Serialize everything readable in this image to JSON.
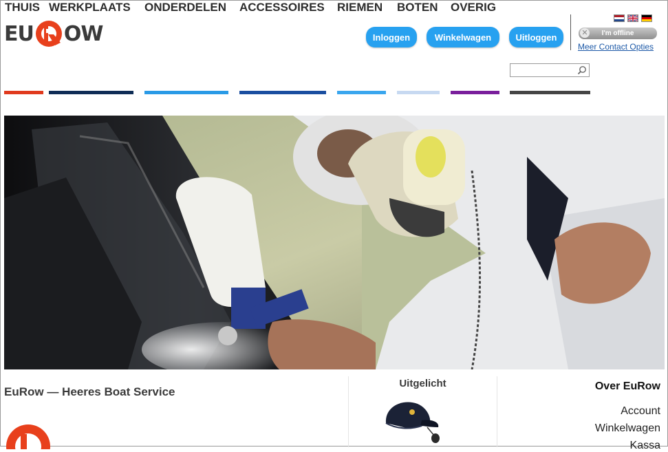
{
  "brand": {
    "logo_left": "EU",
    "logo_right": "OW",
    "accent_color": "#e8401c"
  },
  "header": {
    "buttons": {
      "login": "Inloggen",
      "cart": "Winkelwagen",
      "logout": "Uitloggen"
    },
    "button_color": "#27a1f0",
    "languages": [
      "nl",
      "en",
      "de"
    ],
    "chat_status": "I'm offline",
    "contact_link": "Meer Contact Opties"
  },
  "nav": {
    "items": [
      {
        "label": "THUIS",
        "color": "#e03a1e"
      },
      {
        "label": "WERKPLAATS",
        "color": "#0f2d56"
      },
      {
        "label": "ONDERDELEN",
        "color": "#2a9ae6"
      },
      {
        "label": "ACCESSOIRES",
        "color": "#1a4ea0"
      },
      {
        "label": "RIEMEN",
        "color": "#3aa6ee"
      },
      {
        "label": "BOTEN",
        "color": "#c7d9f1"
      },
      {
        "label": "OVERIG",
        "color": "#7a1f9c"
      }
    ],
    "search_bar_color": "#454545",
    "search_value": ""
  },
  "main": {
    "subtitle": "EuRow — Heeres Boat Service",
    "featured_title": "Uitgelicht",
    "about": {
      "title": "Over EuRow",
      "links": [
        "Account",
        "Winkelwagen",
        "Kassa"
      ]
    }
  }
}
